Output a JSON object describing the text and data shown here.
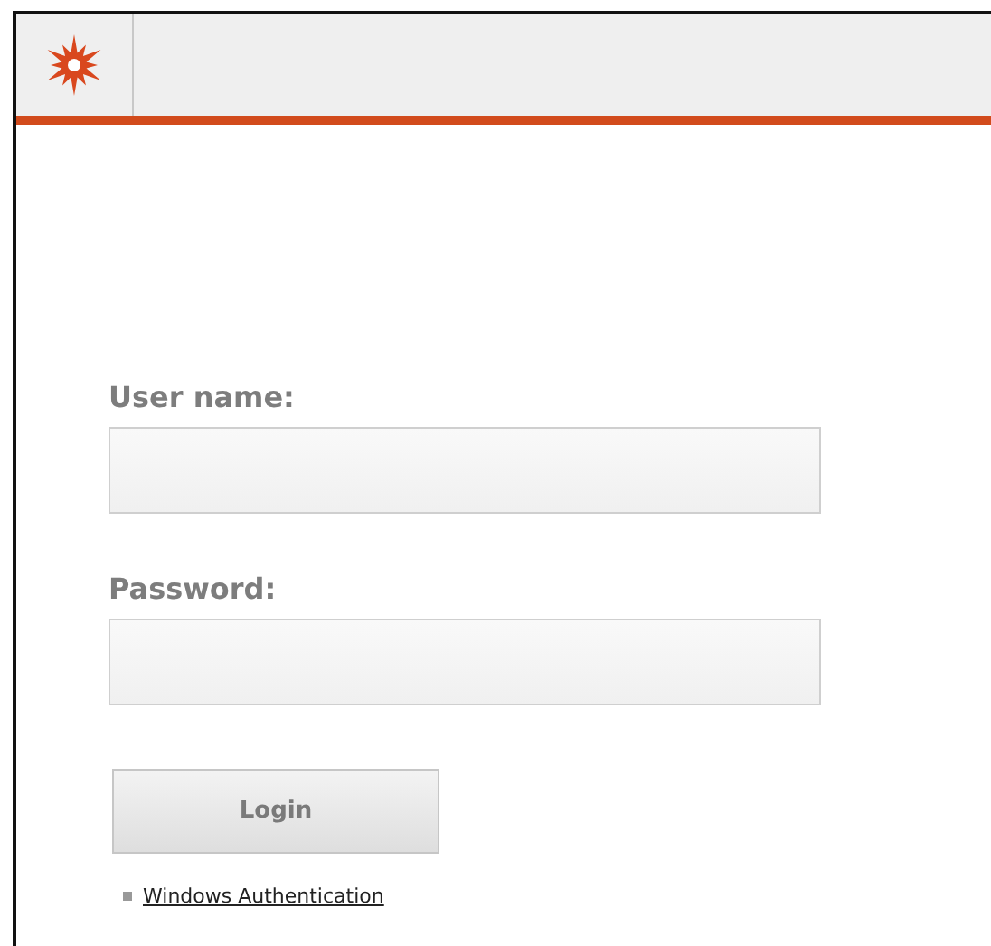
{
  "form": {
    "fields": [
      {
        "label": "User name:"
      },
      {
        "label": "Password:"
      }
    ]
  },
  "login_button": "Login",
  "windows_auth_link": "Windows Authentication"
}
